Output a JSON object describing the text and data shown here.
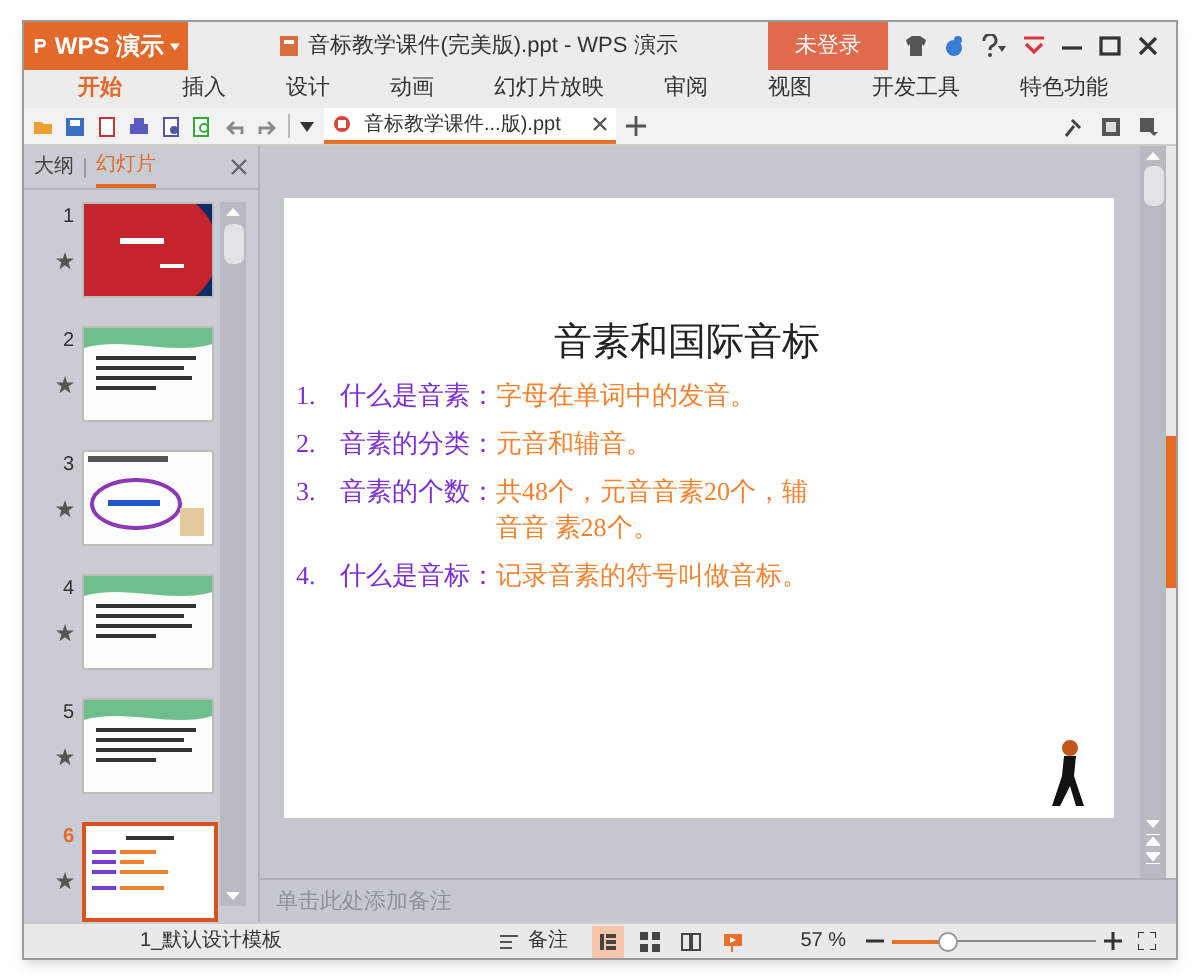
{
  "window": {
    "app_button": "WPS 演示",
    "title": "音标教学课件(完美版).ppt - WPS 演示",
    "login": "未登录"
  },
  "menu_tabs": [
    {
      "label": "开始",
      "selected": true
    },
    {
      "label": "插入",
      "selected": false
    },
    {
      "label": "设计",
      "selected": false
    },
    {
      "label": "动画",
      "selected": false
    },
    {
      "label": "幻灯片放映",
      "selected": false
    },
    {
      "label": "审阅",
      "selected": false
    },
    {
      "label": "视图",
      "selected": false
    },
    {
      "label": "开发工具",
      "selected": false
    },
    {
      "label": "特色功能",
      "selected": false
    }
  ],
  "doc_tabs": [
    {
      "label": "音标教学课件...版).ppt",
      "selected": true
    }
  ],
  "side_panel": {
    "tabs": [
      {
        "label": "大纲",
        "selected": false
      },
      {
        "label": "幻灯片",
        "selected": true
      }
    ],
    "thumbnails": [
      {
        "number": "1",
        "kind": "title",
        "selected": false
      },
      {
        "number": "2",
        "kind": "text",
        "selected": false
      },
      {
        "number": "3",
        "kind": "cloud",
        "selected": false
      },
      {
        "number": "4",
        "kind": "text",
        "selected": false
      },
      {
        "number": "5",
        "kind": "text",
        "selected": false
      },
      {
        "number": "6",
        "kind": "list",
        "selected": true
      }
    ]
  },
  "slide": {
    "title": "音素和国际音标",
    "items": [
      {
        "number": "1.",
        "term": "什么是音素：",
        "definition_lines": [
          "字母在单词中的发音。"
        ]
      },
      {
        "number": "2.",
        "term": "音素的分类：",
        "definition_lines": [
          "元音和辅音。"
        ]
      },
      {
        "number": "3.",
        "term": "音素的个数：",
        "definition_lines": [
          "共48个，元音音素20个，辅",
          "音音 素28个。"
        ]
      },
      {
        "number": "4.",
        "term": "什么是音标：",
        "definition_lines": [
          "记录音素的符号叫做音标。"
        ]
      }
    ]
  },
  "notes": {
    "placeholder": "单击此处添加备注"
  },
  "status_bar": {
    "template": "1_默认设计模板",
    "notes_button": "备注",
    "zoom": "57 %",
    "zoom_slider": {
      "level": 0.27
    }
  }
}
